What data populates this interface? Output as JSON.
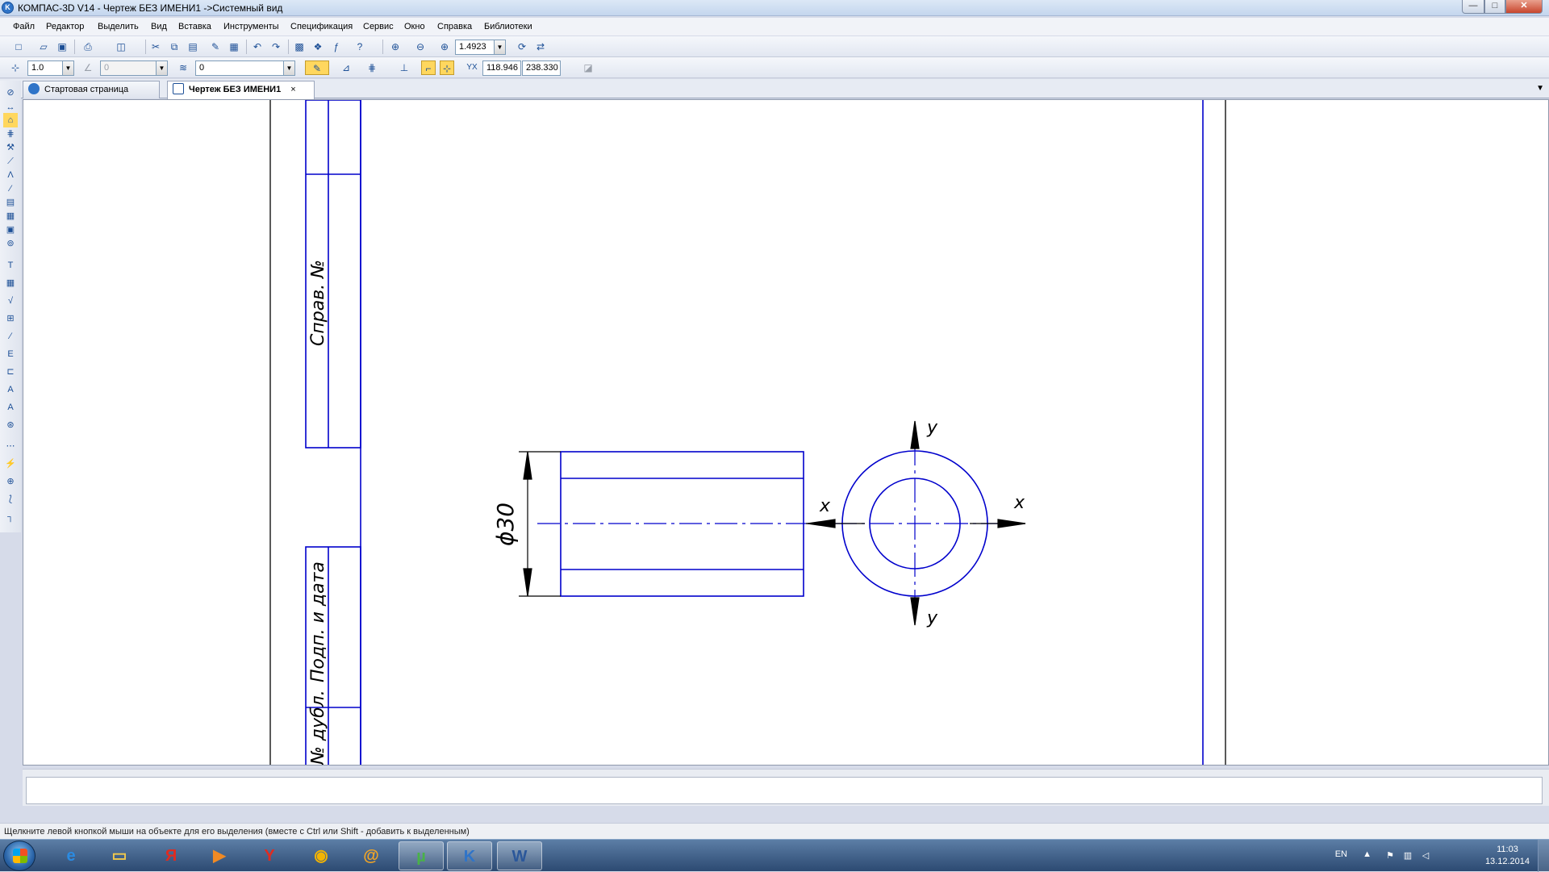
{
  "window": {
    "title": "КОМПАС-3D V14 - Чертеж БЕЗ ИМЕНИ1 ->Системный вид",
    "app_icon": "K",
    "buttons": {
      "minimize": "—",
      "maximize": "□",
      "close": "✕"
    }
  },
  "menu": [
    "Файл",
    "Редактор",
    "Выделить",
    "Вид",
    "Вставка",
    "Инструменты",
    "Спецификация",
    "Сервис",
    "Окно",
    "Справка",
    "Библиотеки"
  ],
  "toolbar1": {
    "icons": [
      "new-doc-icon",
      "open-icon",
      "save-icon",
      "print-icon",
      "preview-icon",
      "cut-icon",
      "copy-icon",
      "paste-icon",
      "format-brush-icon",
      "properties-icon",
      "undo-icon",
      "redo-icon",
      "manager-icon",
      "library-icon",
      "variables-icon",
      "help-icon",
      "zoom-window-icon",
      "zoom-out-icon",
      "zoom-in-icon",
      "refresh-icon",
      "layers-icon"
    ],
    "zoom_value": "1.4923"
  },
  "toolbar2": {
    "step_value": "1.0",
    "angle_value": "0",
    "layer_value": "0",
    "coord_x": "118.946",
    "coord_y": "238.330",
    "coord_label": "Y",
    "coord_label_x": "X"
  },
  "tabs": [
    {
      "label": "Стартовая страница",
      "active": false
    },
    {
      "label": "Чертеж БЕЗ ИМЕНИ1",
      "active": true,
      "close": "×"
    }
  ],
  "tabs_menu": "▼",
  "left_toolbar_icons": [
    "geometry-icon",
    "dimensions-icon",
    "notation-icon",
    "edit-icon",
    "parametrization-icon",
    "measure-icon",
    "select-icon",
    "associative-views-icon",
    "spec-icon",
    "reports-icon",
    "insert-icon",
    "text-icon",
    "table-icon",
    "roughness-icon",
    "base-icon",
    "leader-icon",
    "tolerance-icon",
    "axis-icon",
    "label-icon",
    "view-arrow-icon",
    "section-icon",
    "snap-icon",
    "point-icon",
    "curve-icon",
    "corner-icon"
  ],
  "drawing": {
    "stamp_labels": [
      "Справ. №",
      "Подп. и дата",
      "№ дубл."
    ],
    "dimension": "ϕ30",
    "axis_labels": {
      "x_left": "x",
      "x_right": "x",
      "y_top": "y",
      "y_bottom": "y"
    },
    "line_color": "#0000cc",
    "frame_color": "#000000"
  },
  "status_text": "Щелкните левой кнопкой мыши на объекте для его выделения (вместе с Ctrl или Shift - добавить к выделенным)",
  "taskbar": {
    "apps": [
      "windows-explorer-icon",
      "internet-explorer-icon",
      "file-manager-icon",
      "yandex-browser-icon",
      "media-player-icon",
      "yandex-icon",
      "chrome-icon",
      "mail-agent-icon",
      "utorrent-icon",
      "kompas-icon",
      "word-icon"
    ],
    "language": "EN",
    "time": "11:03",
    "date": "13.12.2014"
  }
}
